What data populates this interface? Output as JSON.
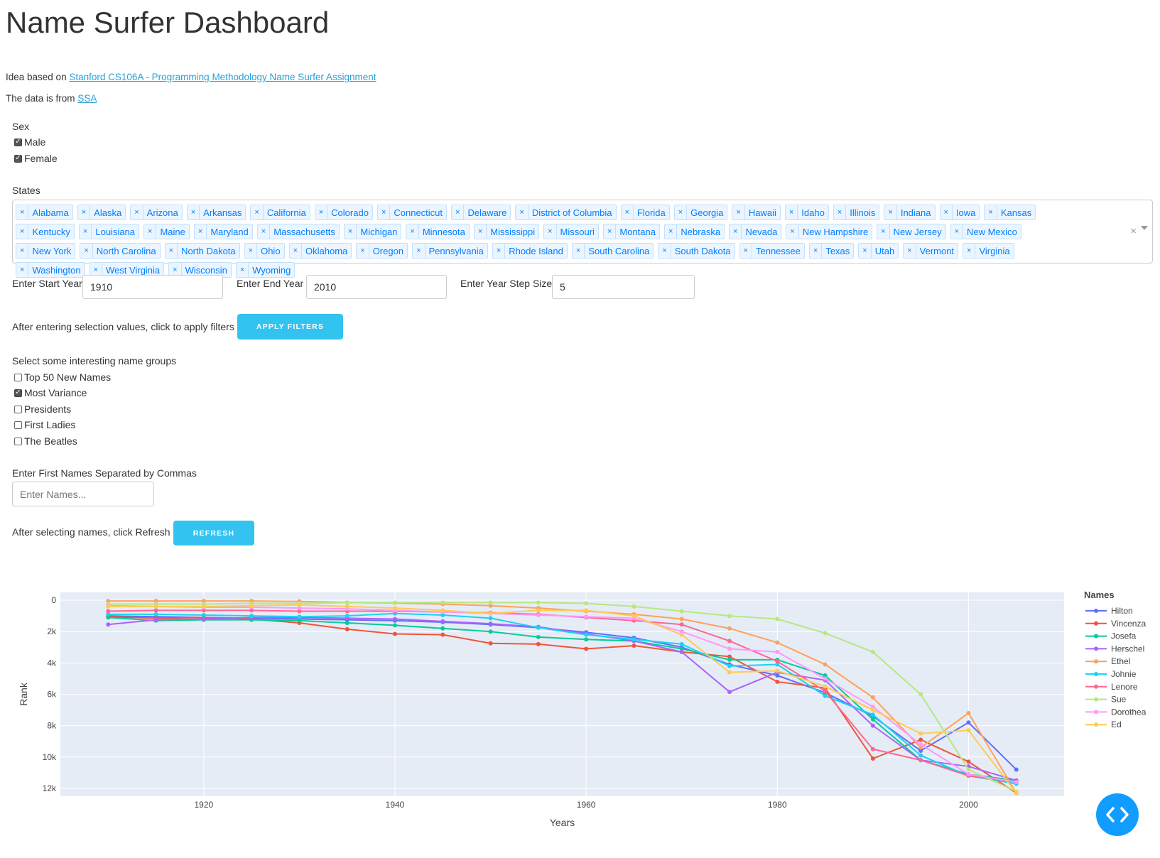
{
  "page_title": "Name Surfer Dashboard",
  "intro": {
    "idea_prefix": "Idea based on",
    "idea_link": "Stanford CS106A - Programming Methodology Name Surfer Assignment",
    "data_prefix": "The data is from",
    "data_link": "SSA"
  },
  "sex": {
    "label": "Sex",
    "options": [
      {
        "label": "Male",
        "checked": true
      },
      {
        "label": "Female",
        "checked": true
      }
    ]
  },
  "states": {
    "label": "States",
    "selected": [
      "Alabama",
      "Alaska",
      "Arizona",
      "Arkansas",
      "California",
      "Colorado",
      "Connecticut",
      "Delaware",
      "District of Columbia",
      "Florida",
      "Georgia",
      "Hawaii",
      "Idaho",
      "Illinois",
      "Indiana",
      "Iowa",
      "Kansas",
      "Kentucky",
      "Louisiana",
      "Maine",
      "Maryland",
      "Massachusetts",
      "Michigan",
      "Minnesota",
      "Mississippi",
      "Missouri",
      "Montana",
      "Nebraska",
      "Nevada",
      "New Hampshire",
      "New Jersey",
      "New Mexico",
      "New York",
      "North Carolina",
      "North Dakota",
      "Ohio",
      "Oklahoma",
      "Oregon",
      "Pennsylvania",
      "Rhode Island",
      "South Carolina",
      "South Dakota",
      "Tennessee",
      "Texas",
      "Utah",
      "Vermont",
      "Virginia",
      "Washington",
      "West Virginia",
      "Wisconsin",
      "Wyoming"
    ],
    "remove_glyph": "×",
    "clear_glyph": "×"
  },
  "years": {
    "start_label": "Enter Start Year",
    "start_value": "1910",
    "end_label": "Enter End Year",
    "end_value": "2010",
    "step_label": "Enter Year Step Size",
    "step_value": "5"
  },
  "apply": {
    "text": "After entering selection values, click to apply filters",
    "button": "APPLY FILTERS"
  },
  "groups": {
    "label": "Select some interesting name groups",
    "options": [
      {
        "label": "Top 50 New Names",
        "checked": false
      },
      {
        "label": "Most Variance",
        "checked": true
      },
      {
        "label": "Presidents",
        "checked": false
      },
      {
        "label": "First Ladies",
        "checked": false
      },
      {
        "label": "The Beatles",
        "checked": false
      }
    ]
  },
  "names": {
    "label": "Enter First Names Separated by Commas",
    "placeholder": "Enter Names..."
  },
  "refresh": {
    "text": "After selecting names, click Refresh",
    "button": "REFRESH"
  },
  "colors": {
    "accent": "#33c3f0",
    "fab": "#119dff",
    "plot_bg": "#e5ecf6"
  },
  "chart_data": {
    "type": "line",
    "xlabel": "Years",
    "ylabel": "Rank",
    "xlim": [
      1905,
      2010
    ],
    "ylim": [
      12500,
      -500
    ],
    "y_reversed": true,
    "xticks": [
      1920,
      1940,
      1960,
      1980,
      2000
    ],
    "yticks": [
      0,
      2000,
      4000,
      6000,
      8000,
      10000,
      12000
    ],
    "ytick_labels": [
      "0",
      "2k",
      "4k",
      "6k",
      "8k",
      "10k",
      "12k"
    ],
    "legend_title": "Names",
    "legend_position": "right",
    "x": [
      1910,
      1915,
      1920,
      1925,
      1930,
      1935,
      1940,
      1945,
      1950,
      1955,
      1960,
      1965,
      1970,
      1975,
      1980,
      1985,
      1990,
      1995,
      2000,
      2005
    ],
    "series": [
      {
        "name": "Hilton",
        "color": "#636efa",
        "values": [
          1000,
          1050,
          1100,
          1150,
          1200,
          1250,
          1300,
          1400,
          1550,
          1750,
          2050,
          2400,
          3000,
          4100,
          4800,
          5900,
          7400,
          9600,
          7800,
          10800
        ]
      },
      {
        "name": "Vincenza",
        "color": "#ef553b",
        "values": [
          1050,
          1150,
          1100,
          1200,
          1450,
          1850,
          2150,
          2200,
          2750,
          2800,
          3100,
          2900,
          3300,
          3600,
          5200,
          5600,
          10100,
          8900,
          10300,
          12300
        ]
      },
      {
        "name": "Josefa",
        "color": "#00cc96",
        "values": [
          1100,
          1300,
          1250,
          1250,
          1300,
          1450,
          1600,
          1800,
          2000,
          2350,
          2500,
          2600,
          3100,
          3800,
          3800,
          4800,
          7600,
          10200,
          11100,
          11500
        ]
      },
      {
        "name": "Herschel",
        "color": "#ab63fa",
        "values": [
          1550,
          1250,
          1200,
          1100,
          1100,
          1150,
          1200,
          1350,
          1500,
          1700,
          2150,
          2600,
          3300,
          5850,
          4600,
          5100,
          8000,
          10200,
          10600,
          11500
        ]
      },
      {
        "name": "Ethel",
        "color": "#ffa15a",
        "values": [
          50,
          50,
          50,
          50,
          80,
          150,
          180,
          250,
          350,
          500,
          700,
          900,
          1200,
          1800,
          2700,
          4100,
          6200,
          9400,
          7200,
          12300
        ]
      },
      {
        "name": "Johnie",
        "color": "#19d3f3",
        "values": [
          900,
          900,
          950,
          1000,
          1050,
          1000,
          850,
          950,
          1150,
          1750,
          2200,
          2500,
          2800,
          4200,
          4100,
          6100,
          7300,
          9900,
          11200,
          11700
        ]
      },
      {
        "name": "Lenore",
        "color": "#ff6692",
        "values": [
          700,
          650,
          650,
          650,
          700,
          700,
          700,
          750,
          800,
          900,
          1100,
          1300,
          1550,
          2600,
          3900,
          5800,
          9500,
          10200,
          11200,
          11600
        ]
      },
      {
        "name": "Sue",
        "color": "#b6e880",
        "values": [
          250,
          250,
          250,
          200,
          200,
          150,
          150,
          150,
          150,
          150,
          200,
          400,
          700,
          1000,
          1200,
          2100,
          3300,
          6000,
          10800,
          12200
        ]
      },
      {
        "name": "Dorothea",
        "color": "#ff97ff",
        "values": [
          350,
          400,
          450,
          450,
          500,
          550,
          650,
          750,
          850,
          950,
          1050,
          1150,
          2000,
          3100,
          3300,
          5000,
          6800,
          9200,
          11100,
          11600
        ]
      },
      {
        "name": "Ed",
        "color": "#fecb52",
        "values": [
          400,
          400,
          400,
          350,
          300,
          400,
          500,
          650,
          850,
          650,
          650,
          1000,
          2200,
          4600,
          4500,
          5500,
          7000,
          8500,
          8300,
          12300
        ]
      }
    ]
  }
}
